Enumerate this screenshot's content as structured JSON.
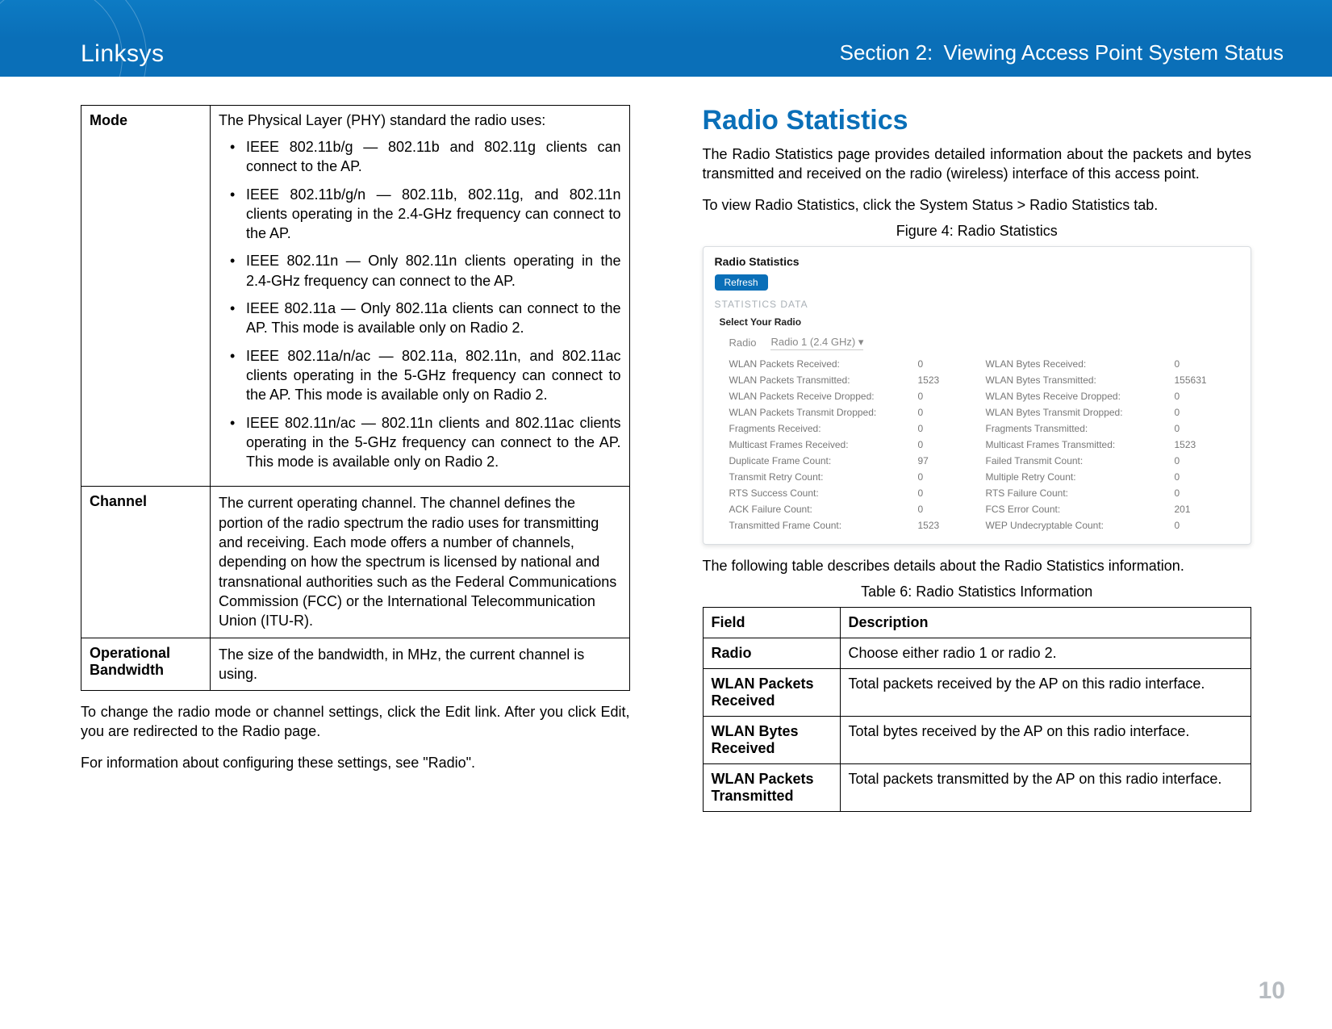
{
  "header": {
    "brand": "Linksys",
    "section_label": "Section 2",
    "section_name": "Viewing Access Point System Status"
  },
  "left": {
    "mode_label": "Mode",
    "mode_intro": "The Physical Layer (PHY) standard the radio uses:",
    "mode_items": [
      "IEEE 802.11b/g — 802.11b and 802.11g clients can connect to the AP.",
      "IEEE 802.11b/g/n — 802.11b, 802.11g, and 802.11n clients operating in the 2.4-GHz frequency can connect to the AP.",
      "IEEE 802.11n — Only 802.11n clients operating in the 2.4-GHz frequency can connect to the AP.",
      "IEEE 802.11a — Only 802.11a clients can connect to the AP. This mode is available only on Radio 2.",
      "IEEE 802.11a/n/ac — 802.11a, 802.11n, and 802.11ac clients operating in the 5-GHz frequency can connect to the AP. This mode is available only on Radio 2.",
      "IEEE 802.11n/ac — 802.11n clients and 802.11ac clients operating in the 5-GHz frequency can connect to the AP. This mode is available only on Radio 2."
    ],
    "channel_label": "Channel",
    "channel_desc": "The current operating channel. The channel defines the portion of the radio spectrum the radio uses for transmitting and receiving. Each mode offers a number of channels, depending on how the spectrum is licensed by national and transnational authorities such as the Federal Communications Commission (FCC) or the International Telecommunication Union (ITU-R).",
    "opbw_label": "Operational Bandwidth",
    "opbw_desc": "The size of the bandwidth, in MHz, the current channel is using.",
    "after1": "To change the radio mode or channel settings, click the Edit link. After you click Edit, you are redirected to the Radio page.",
    "after2": "For information about configuring these settings, see \"Radio\"."
  },
  "right": {
    "title": "Radio Statistics",
    "intro": "The Radio Statistics page provides detailed information about the packets and bytes transmitted and received on the radio (wireless) interface of this access point.",
    "howto": "To view Radio Statistics, click the System Status > Radio Statistics tab.",
    "figure_caption": "Figure 4: Radio Statistics",
    "shot": {
      "heading": "Radio Statistics",
      "refresh": "Refresh",
      "section": "STATISTICS DATA",
      "select_label": "Select Your Radio",
      "radio_label": "Radio",
      "radio_value": "Radio 1 (2.4 GHz)",
      "rows": [
        {
          "l1": "WLAN Packets Received:",
          "v1": "0",
          "l2": "WLAN Bytes Received:",
          "v2": "0"
        },
        {
          "l1": "WLAN Packets Transmitted:",
          "v1": "1523",
          "l2": "WLAN Bytes Transmitted:",
          "v2": "155631"
        },
        {
          "l1": "WLAN Packets Receive Dropped:",
          "v1": "0",
          "l2": "WLAN Bytes Receive Dropped:",
          "v2": "0"
        },
        {
          "l1": "WLAN Packets Transmit Dropped:",
          "v1": "0",
          "l2": "WLAN Bytes Transmit Dropped:",
          "v2": "0"
        },
        {
          "l1": "Fragments Received:",
          "v1": "0",
          "l2": "Fragments Transmitted:",
          "v2": "0"
        },
        {
          "l1": "Multicast Frames Received:",
          "v1": "0",
          "l2": "Multicast Frames Transmitted:",
          "v2": "1523"
        },
        {
          "l1": "Duplicate Frame Count:",
          "v1": "97",
          "l2": "Failed Transmit Count:",
          "v2": "0"
        },
        {
          "l1": "Transmit Retry Count:",
          "v1": "0",
          "l2": "Multiple Retry Count:",
          "v2": "0"
        },
        {
          "l1": "RTS Success Count:",
          "v1": "0",
          "l2": "RTS Failure Count:",
          "v2": "0"
        },
        {
          "l1": "ACK Failure Count:",
          "v1": "0",
          "l2": "FCS Error Count:",
          "v2": "201"
        },
        {
          "l1": "Transmitted Frame Count:",
          "v1": "1523",
          "l2": "WEP Undecryptable Count:",
          "v2": "0"
        }
      ]
    },
    "after_shot": "The following table describes details about the Radio Statistics information.",
    "table_caption": "Table 6: Radio Statistics Information",
    "info_headers": {
      "field": "Field",
      "desc": "Description"
    },
    "info_rows": [
      {
        "f": "Radio",
        "d": "Choose either radio 1 or radio 2."
      },
      {
        "f": "WLAN Packets Received",
        "d": "Total packets received by the AP on this radio interface."
      },
      {
        "f": "WLAN Bytes Received",
        "d": "Total bytes received by the AP on this radio interface."
      },
      {
        "f": "WLAN Packets Transmitted",
        "d": "Total packets transmitted by the AP on this radio interface."
      }
    ]
  },
  "page_number": "10"
}
